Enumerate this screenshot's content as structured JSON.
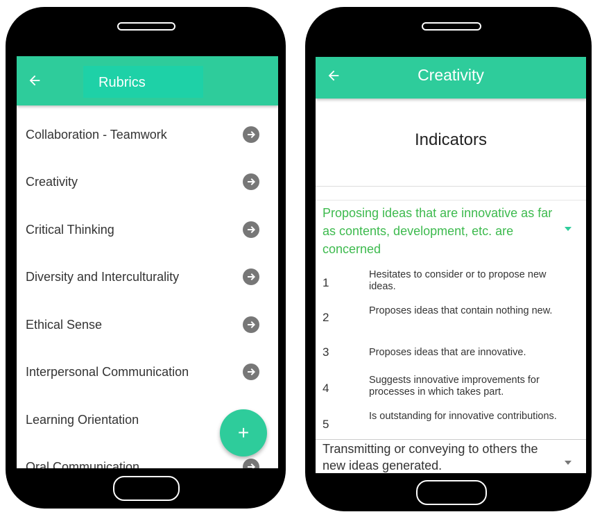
{
  "left_screen": {
    "header": {
      "title": "Rubrics"
    },
    "rubrics": [
      {
        "label": "Collaboration - Teamwork"
      },
      {
        "label": "Creativity"
      },
      {
        "label": "Critical Thinking"
      },
      {
        "label": "Diversity and Interculturality"
      },
      {
        "label": "Ethical Sense"
      },
      {
        "label": "Interpersonal Communication"
      },
      {
        "label": "Learning Orientation"
      },
      {
        "label": "Oral Communication"
      }
    ],
    "fab": {
      "label": "+"
    }
  },
  "right_screen": {
    "header": {
      "title": "Creativity"
    },
    "section_title": "Indicators",
    "indicators": [
      {
        "title": "Proposing ideas that are innovative as far as contents, development, etc. are concerned",
        "expanded": true,
        "levels": [
          {
            "num": "1",
            "text": "Hesitates to consider or to propose new ideas."
          },
          {
            "num": "2",
            "text": "Proposes ideas that contain nothing new."
          },
          {
            "num": "3",
            "text": "Proposes ideas that are innovative."
          },
          {
            "num": "4",
            "text": "Suggests innovative improvements for processes in which takes part."
          },
          {
            "num": "5",
            "text": "Is outstanding for innovative contributions."
          }
        ]
      },
      {
        "title": "Transmitting or conveying to others the new ideas generated.",
        "expanded": false
      }
    ]
  },
  "colors": {
    "accent": "#2ecc9b",
    "expanded_text": "#3dba4e",
    "icon_gray": "#777777"
  },
  "icons": [
    "arrow-back-icon",
    "arrow-circle-right-icon",
    "plus-icon",
    "caret-down-icon"
  ]
}
